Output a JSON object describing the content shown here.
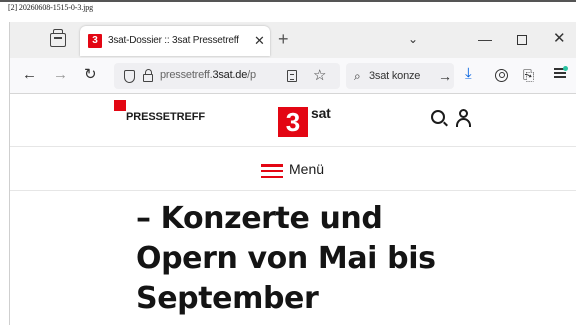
{
  "file_caption": "[2] 20260608-1515-0-3.jpg",
  "browser": {
    "tab": {
      "favicon_text": "3",
      "title": "3sat-Dossier :: 3sat Pressetreff",
      "close_glyph": "✕"
    },
    "new_tab_glyph": "+",
    "tab_list_glyph": "⌄",
    "window_controls": {
      "minimize": "—",
      "close": "✕"
    },
    "nav": {
      "back": "←",
      "forward": "→",
      "reload": "↻"
    },
    "url": {
      "prefix": "pressetreff.",
      "host": "3sat.de",
      "suffix": "/p"
    },
    "bookmark_star": "☆",
    "search": {
      "value": "3sat konze",
      "go_glyph": "→"
    },
    "download_glyph": "⤓",
    "extensions_glyph": "⎘"
  },
  "site": {
    "logo_text": "PRESSETREFF",
    "brand_number": "3",
    "brand_word": "sat",
    "menu_label": "Menü",
    "headline_lines": [
      "– Konzerte und",
      "Opern von Mai bis",
      "September"
    ]
  },
  "colors": {
    "brand_red": "#e30613",
    "download_blue": "#0060df",
    "update_dot": "#2ac3a2"
  }
}
